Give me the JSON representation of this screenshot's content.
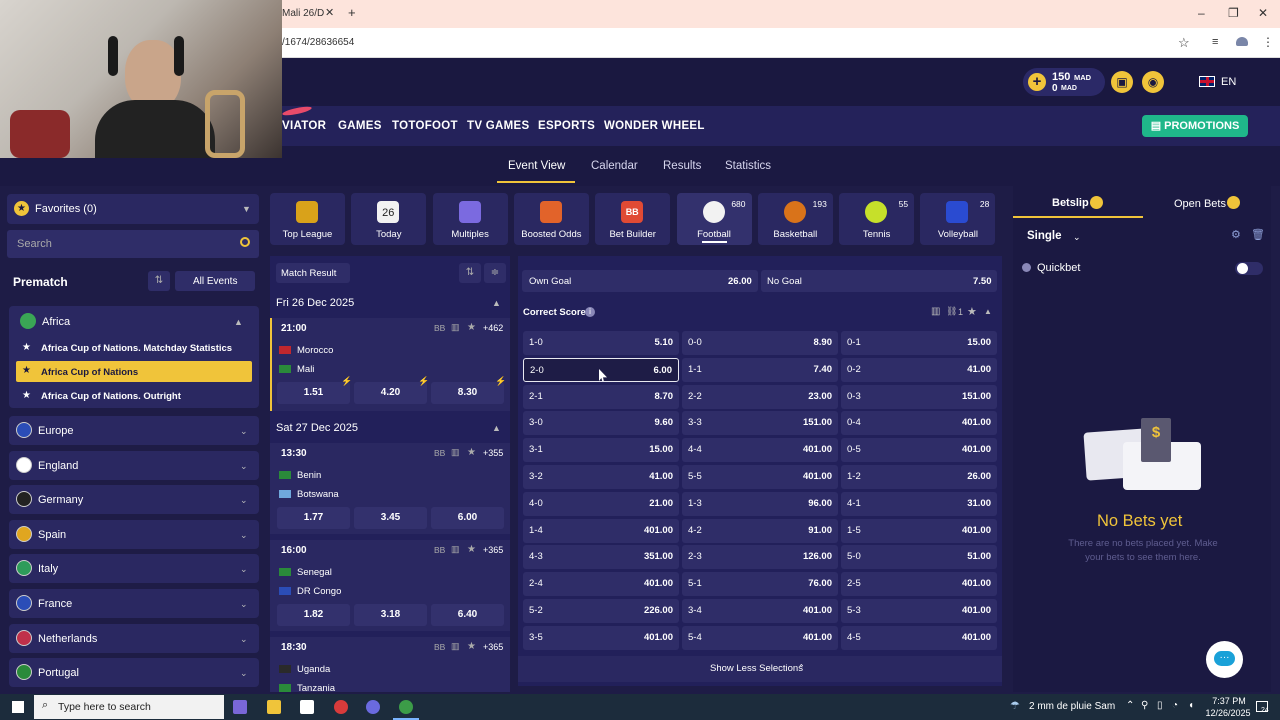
{
  "browser": {
    "tab_title": "Mali 26/D",
    "url": "/1674/28636654",
    "new_tab": "+",
    "minimize": "–",
    "restore": "❐",
    "close": "✕"
  },
  "header": {
    "balance_amount": "150",
    "balance_currency": "MAD",
    "bonus_amount": "0",
    "bonus_currency": "MAD",
    "language": "EN"
  },
  "nav": {
    "items": [
      "VIATOR",
      "GAMES",
      "TOTOFOOT",
      "TV GAMES",
      "ESPORTS",
      "WONDER WHEEL"
    ],
    "promotions": "PROMOTIONS"
  },
  "subnav": {
    "items": [
      "Event View",
      "Calendar",
      "Results",
      "Statistics"
    ]
  },
  "sidebar": {
    "favorites": "Favorites (0)",
    "search_placeholder": "Search",
    "prematch": "Prematch",
    "all_events": "All Events",
    "africa": "Africa",
    "africa_children": [
      "Africa Cup of Nations. Matchday Statistics",
      "Africa Cup of Nations",
      "Africa Cup of Nations. Outright"
    ],
    "countries": [
      "Europe",
      "England",
      "Germany",
      "Spain",
      "Italy",
      "France",
      "Netherlands",
      "Portugal"
    ]
  },
  "sports": [
    {
      "name": "Top League",
      "count": ""
    },
    {
      "name": "Today",
      "count": ""
    },
    {
      "name": "Multiples",
      "count": ""
    },
    {
      "name": "Boosted Odds",
      "count": ""
    },
    {
      "name": "Bet Builder",
      "count": ""
    },
    {
      "name": "Football",
      "count": "680"
    },
    {
      "name": "Basketball",
      "count": "193"
    },
    {
      "name": "Tennis",
      "count": "55"
    },
    {
      "name": "Volleyball",
      "count": "28"
    }
  ],
  "today_num": "26",
  "bb": "BB",
  "matches": {
    "filter": "Match Result",
    "day1": "Fri 26 Dec 2025",
    "day2": "Sat 27 Dec 2025",
    "list": [
      {
        "time": "21:00",
        "more": "+462",
        "home": "Morocco",
        "away": "Mali",
        "odds": [
          "1.51",
          "4.20",
          "8.30"
        ]
      },
      {
        "time": "13:30",
        "more": "+355",
        "home": "Benin",
        "away": "Botswana",
        "odds": [
          "1.77",
          "3.45",
          "6.00"
        ]
      },
      {
        "time": "16:00",
        "more": "+365",
        "home": "Senegal",
        "away": "DR Congo",
        "odds": [
          "1.82",
          "3.18",
          "6.40"
        ]
      },
      {
        "time": "18:30",
        "more": "+365",
        "home": "Uganda",
        "away": "Tanzania"
      }
    ]
  },
  "market": {
    "own_goal_label": "Own Goal",
    "own_goal_odd": "26.00",
    "no_goal_label": "No Goal",
    "no_goal_odd": "7.50",
    "title": "Correct Score",
    "link_count": "1",
    "col1": [
      [
        "1-0",
        "5.10"
      ],
      [
        "2-0",
        "6.00"
      ],
      [
        "2-1",
        "8.70"
      ],
      [
        "3-0",
        "9.60"
      ],
      [
        "3-1",
        "15.00"
      ],
      [
        "3-2",
        "41.00"
      ],
      [
        "4-0",
        "21.00"
      ],
      [
        "1-4",
        "401.00"
      ],
      [
        "4-3",
        "351.00"
      ],
      [
        "2-4",
        "401.00"
      ],
      [
        "5-2",
        "226.00"
      ],
      [
        "3-5",
        "401.00"
      ]
    ],
    "col2": [
      [
        "0-0",
        "8.90"
      ],
      [
        "1-1",
        "7.40"
      ],
      [
        "2-2",
        "23.00"
      ],
      [
        "3-3",
        "151.00"
      ],
      [
        "4-4",
        "401.00"
      ],
      [
        "5-5",
        "401.00"
      ],
      [
        "1-3",
        "96.00"
      ],
      [
        "4-2",
        "91.00"
      ],
      [
        "2-3",
        "126.00"
      ],
      [
        "5-1",
        "76.00"
      ],
      [
        "3-4",
        "401.00"
      ],
      [
        "5-4",
        "401.00"
      ]
    ],
    "col3": [
      [
        "0-1",
        "15.00"
      ],
      [
        "0-2",
        "41.00"
      ],
      [
        "0-3",
        "151.00"
      ],
      [
        "0-4",
        "401.00"
      ],
      [
        "0-5",
        "401.00"
      ],
      [
        "1-2",
        "26.00"
      ],
      [
        "4-1",
        "31.00"
      ],
      [
        "1-5",
        "401.00"
      ],
      [
        "5-0",
        "51.00"
      ],
      [
        "2-5",
        "401.00"
      ],
      [
        "5-3",
        "401.00"
      ],
      [
        "4-5",
        "401.00"
      ]
    ],
    "show_less": "Show Less Selections"
  },
  "betslip": {
    "tab1": "Betslip",
    "tab2": "Open Bets",
    "single": "Single",
    "quickbet": "Quickbet",
    "empty_title": "No Bets yet",
    "empty_text": "There are no bets placed yet. Make your bets to see them here."
  },
  "taskbar": {
    "search": "Type here to search",
    "weather": "2 mm de pluie Sam",
    "time": "7:37 PM",
    "date": "12/26/2025",
    "notif": "24"
  },
  "colors": {
    "accent": "#f0c43a",
    "bg": "#1e1c46",
    "panel": "#2a2861",
    "promo": "#1fb78a",
    "empty_title": "#f0c43a"
  }
}
